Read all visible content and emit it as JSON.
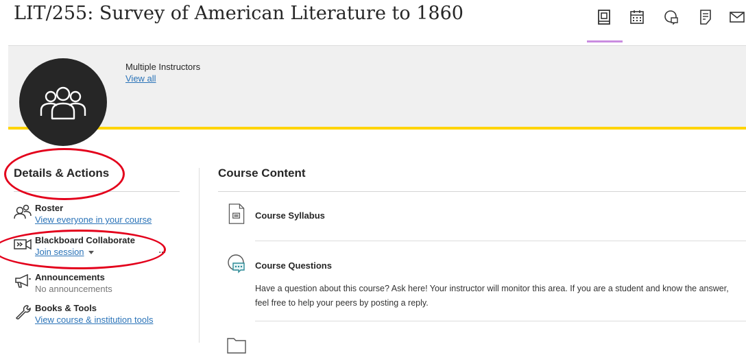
{
  "page": {
    "title": "LIT/255: Survey of American Literature to 1860"
  },
  "top_nav": {
    "icons": [
      "content-icon",
      "calendar-icon",
      "discussions-icon",
      "gradebook-icon",
      "messages-icon"
    ]
  },
  "instructors": {
    "label": "Multiple Instructors",
    "link": "View all"
  },
  "details": {
    "heading": "Details & Actions",
    "items": [
      {
        "title": "Roster",
        "subtitle": "View everyone in your course",
        "icon": "roster-icon"
      },
      {
        "title": "Blackboard Collaborate",
        "subtitle": "Join session",
        "icon": "collaborate-icon"
      },
      {
        "title": "Announcements",
        "subtitle": "No announcements",
        "icon": "megaphone-icon"
      },
      {
        "title": "Books & Tools",
        "subtitle": "View course & institution tools",
        "icon": "wrench-icon"
      }
    ],
    "more_label": "..."
  },
  "content": {
    "heading": "Course Content",
    "items": [
      {
        "title": "Course Syllabus",
        "icon": "document-icon"
      },
      {
        "title": "Course Questions",
        "icon": "discussion-icon",
        "description": "Have a question about this course? Ask here! Your instructor will monitor this area. If you are a student and know the answer, feel free to help your peers by posting a reply."
      }
    ]
  },
  "colors": {
    "accent_yellow": "#ffd400",
    "link": "#2a73b8",
    "annotation_red": "#e3001b",
    "tab_indicator": "#c98ce0"
  }
}
